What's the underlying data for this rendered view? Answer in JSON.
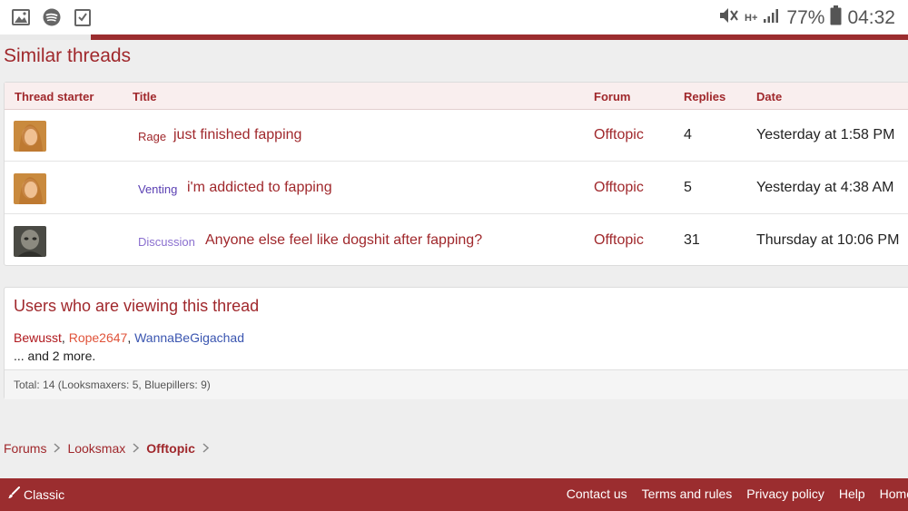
{
  "status": {
    "signal_label": "H+",
    "battery": "77%",
    "time": "04:32"
  },
  "similar": {
    "title": "Similar threads",
    "headers": {
      "starter": "Thread starter",
      "title": "Title",
      "forum": "Forum",
      "replies": "Replies",
      "date": "Date"
    },
    "rows": [
      {
        "prefix": "Rage",
        "prefix_color": "#a0282c",
        "title": "just finished fapping",
        "forum": "Offtopic",
        "replies": "4",
        "date": "Yesterday at 1:58 PM"
      },
      {
        "prefix": "Venting",
        "prefix_color": "#5a3fb3",
        "title": "i'm addicted to fapping",
        "forum": "Offtopic",
        "replies": "5",
        "date": "Yesterday at 4:38 AM"
      },
      {
        "prefix": "Discussion",
        "prefix_color": "#8a6fcf",
        "title": "Anyone else feel like dogshit after fapping?",
        "forum": "Offtopic",
        "replies": "31",
        "date": "Thursday at 10:06 PM"
      }
    ]
  },
  "viewers": {
    "title": "Users who are viewing this thread",
    "users": [
      {
        "name": "Bewusst",
        "color": "#b0191e"
      },
      {
        "name": "Rope2647",
        "color": "#e0533a"
      },
      {
        "name": "WannaBeGigachad",
        "color": "#3a55b0"
      }
    ],
    "sep": ", ",
    "more": "... and 2 more.",
    "total": "Total: 14 (Looksmaxers: 5, Bluepillers: 9)"
  },
  "breadcrumb": {
    "items": [
      "Forums",
      "Looksmax",
      "Offtopic"
    ]
  },
  "footer": {
    "style_label": "Classic",
    "links": [
      "Contact us",
      "Terms and rules",
      "Privacy policy",
      "Help",
      "Home"
    ]
  },
  "colors": {
    "brand": "#9b2d2f",
    "link": "#a0282c"
  }
}
